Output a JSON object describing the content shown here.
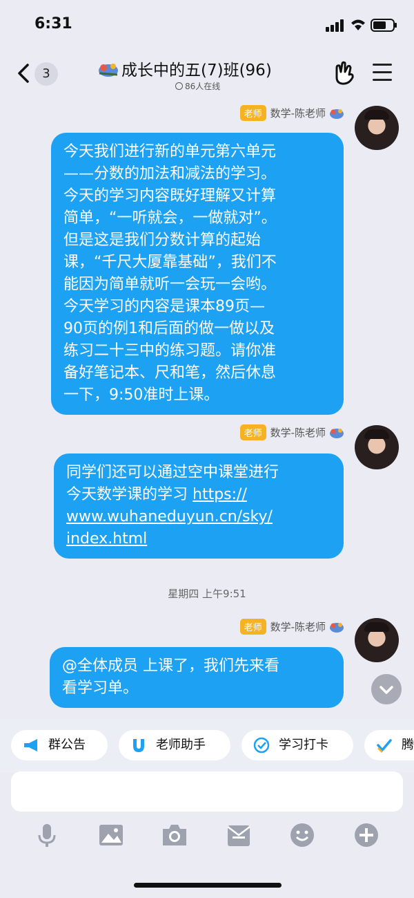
{
  "status": {
    "time": "6:31"
  },
  "header": {
    "unread_count": "3",
    "title": "成长中的五(7)班(96)",
    "online": "86人在线"
  },
  "messages": [
    {
      "role": "老师",
      "sender": "数学-陈老师",
      "lines": [
        "今天我们进行新的单元第六单元",
        "——分数的加法和减法的学习。",
        "今天的学习内容既好理解又计算",
        "简单，“一听就会，一做就对”。",
        "但是这是我们分数计算的起始",
        "课，“千尺大厦靠基础”，我们不",
        "能因为简单就听一会玩一会哟。",
        "今天学习的内容是课本89页—",
        "90页的例1和后面的做一做以及",
        "练习二十三中的练习题。请你准",
        "备好笔记本、尺和笔，然后休息",
        "一下，9:50准时上课。"
      ]
    },
    {
      "role": "老师",
      "sender": "数学-陈老师",
      "line1": "同学们还可以通过空中课堂进行",
      "line2_text": "今天数学课的学习 ",
      "link": "https://",
      "link2": "www.wuhaneduyun.cn/sky/",
      "link3": "index.html"
    },
    {
      "timestamp": "星期四 上午9:51",
      "role": "老师",
      "sender": "数学-陈老师",
      "lines": [
        "@全体成员 上课了，我们先来看",
        "看学习单。"
      ]
    }
  ],
  "quick_actions": [
    {
      "label": "群公告",
      "icon": "megaphone-icon"
    },
    {
      "label": "老师助手",
      "icon": "magnet-icon"
    },
    {
      "label": "学习打卡",
      "icon": "check-circle-icon"
    },
    {
      "label": "腾",
      "icon": "checkmark-icon"
    }
  ],
  "toolbar_icons": [
    "mic-icon",
    "image-icon",
    "camera-icon",
    "envelope-icon",
    "emoji-icon",
    "plus-icon"
  ],
  "colors": {
    "bubble": "#1da1f2",
    "role_badge": "#f5b324",
    "background": "#ebecf3"
  }
}
